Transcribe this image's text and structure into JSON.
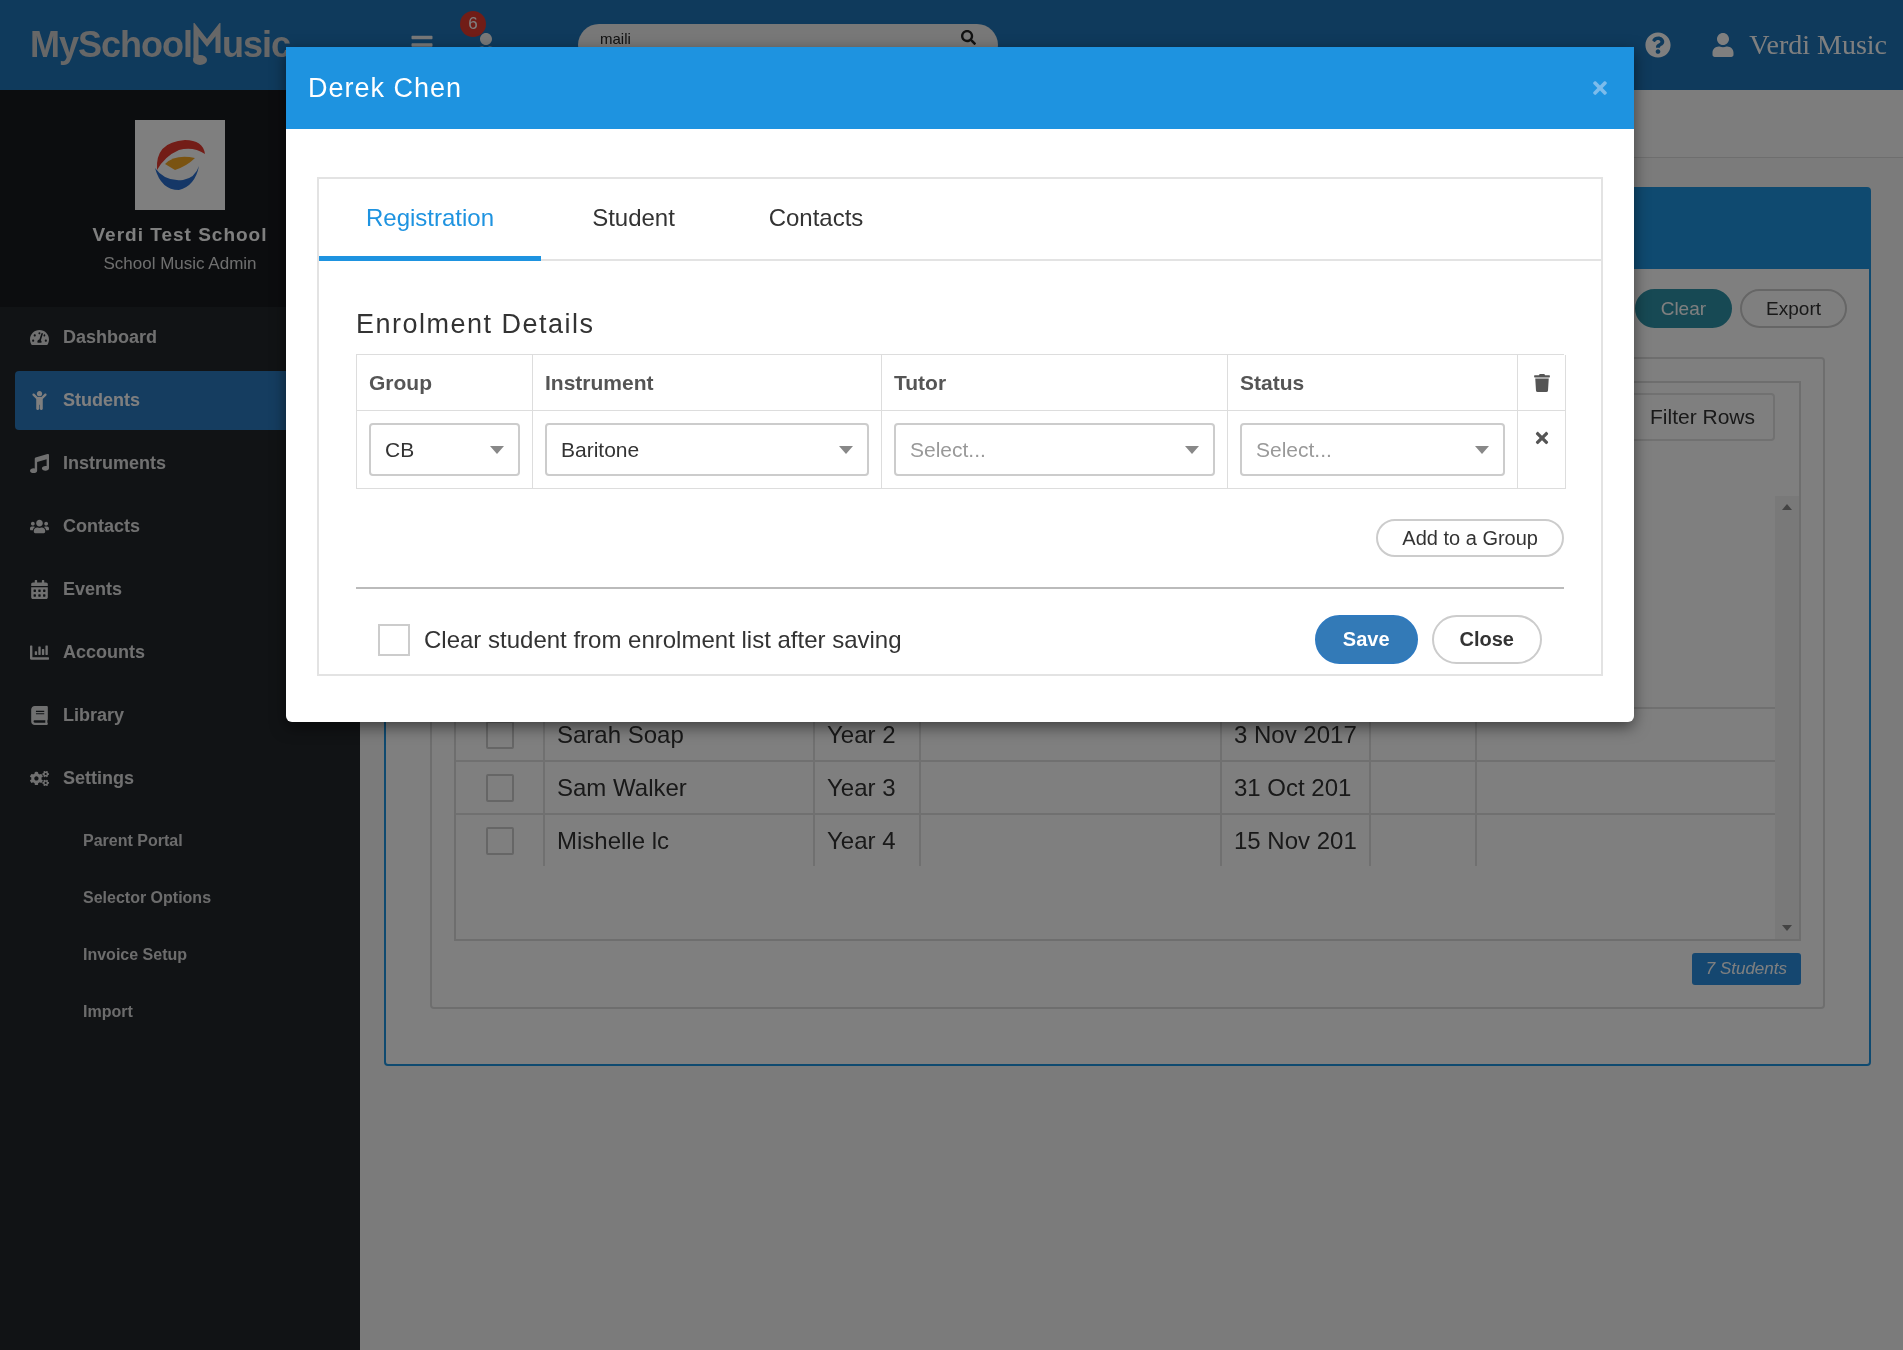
{
  "header": {
    "logo_start": "MySchool",
    "logo_end": "usic",
    "notification_count": "6",
    "search_value": "maili",
    "user_name": "Verdi Music"
  },
  "sidebar": {
    "school_name": "Verdi Test School",
    "role": "School Music Admin",
    "items": [
      {
        "label": "Dashboard",
        "selected": false
      },
      {
        "label": "Students",
        "selected": true
      },
      {
        "label": "Instruments",
        "selected": false
      },
      {
        "label": "Contacts",
        "selected": false
      },
      {
        "label": "Events",
        "selected": false
      },
      {
        "label": "Accounts",
        "selected": false
      },
      {
        "label": "Library",
        "selected": false
      },
      {
        "label": "Settings",
        "selected": false
      }
    ],
    "sub_items": [
      "Parent Portal",
      "Selector Options",
      "Invoice Setup",
      "Import"
    ]
  },
  "background_panel": {
    "buttons": [
      {
        "label": "Clear",
        "kind": "primary"
      },
      {
        "label": "Export",
        "kind": "default"
      }
    ],
    "filter_button": "Filter Rows",
    "rows": [
      {
        "checked": false,
        "name": "Sarah Soap",
        "year": "Year 2",
        "date": "3 Nov 2017"
      },
      {
        "checked": false,
        "name": "Sam Walker",
        "year": "Year 3",
        "date": "31 Oct 201"
      },
      {
        "checked": false,
        "name": "Mishelle lc",
        "year": "Year 4",
        "date": "15 Nov 201"
      }
    ],
    "count_badge": "7 Students"
  },
  "modal": {
    "title": "Derek Chen",
    "tabs": [
      {
        "label": "Registration",
        "selected": true
      },
      {
        "label": "Student",
        "selected": false
      },
      {
        "label": "Contacts",
        "selected": false
      }
    ],
    "section_title": "Enrolment Details",
    "columns": [
      "Group",
      "Instrument",
      "Tutor",
      "Status"
    ],
    "cells": [
      {
        "value": "CB"
      },
      {
        "value": "Baritone"
      },
      {
        "placeholder": "Select..."
      },
      {
        "placeholder": "Select..."
      }
    ],
    "add_group_button": "Add to a Group",
    "clear_checkbox": {
      "label": "Clear student from enrolment list after saving",
      "checked": false
    },
    "buttons": [
      {
        "label": "Save",
        "kind": "primary"
      },
      {
        "label": "Close",
        "kind": "default"
      }
    ]
  }
}
